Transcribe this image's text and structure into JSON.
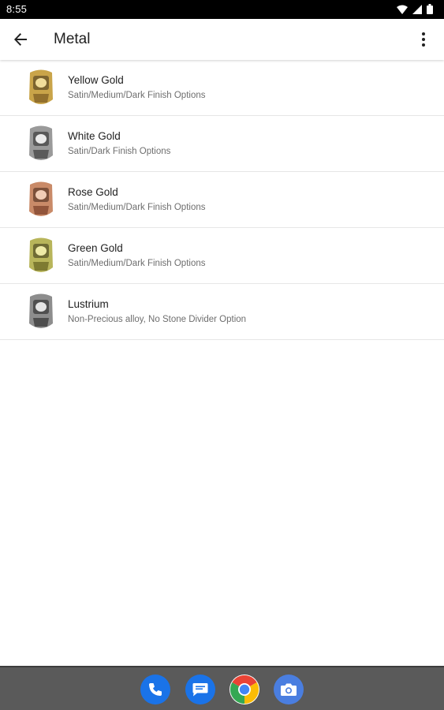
{
  "status_bar": {
    "time": "8:55"
  },
  "app_bar": {
    "title": "Metal"
  },
  "metals": [
    {
      "name": "Yellow Gold",
      "description": "Satin/Medium/Dark Finish Options",
      "color": "#c9a449"
    },
    {
      "name": "White Gold",
      "description": "Satin/Dark Finish Options",
      "color": "#9a9a9a"
    },
    {
      "name": "Rose Gold",
      "description": "Satin/Medium/Dark Finish Options",
      "color": "#c98a68"
    },
    {
      "name": "Green Gold",
      "description": "Satin/Medium/Dark Finish Options",
      "color": "#b8b55a"
    },
    {
      "name": "Lustrium",
      "description": "Non-Precious alloy, No Stone Divider Option",
      "color": "#8d8d8d"
    }
  ],
  "dock": [
    {
      "icon": "phone-icon",
      "color": "#1a73e8"
    },
    {
      "icon": "messages-icon",
      "color": "#1a73e8"
    },
    {
      "icon": "chrome-icon",
      "color": "#ea4335"
    },
    {
      "icon": "camera-icon",
      "color": "#4a7ee0"
    }
  ]
}
